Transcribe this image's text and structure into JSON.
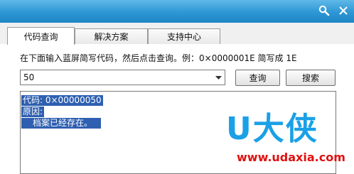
{
  "titlebar": {
    "search_icon": "magnifier-icon",
    "close_icon": "close-icon",
    "color": "#2d96d4"
  },
  "tabs": [
    {
      "label": "代码查询",
      "active": true
    },
    {
      "label": "解决方案",
      "active": false
    },
    {
      "label": "支持中心",
      "active": false
    }
  ],
  "instruction": "在下面输入蓝屏简写代码，然后点击查询。例：0×0000001E 简写成 1E",
  "code_input": {
    "value": "50"
  },
  "buttons": {
    "query": "查询",
    "search": "搜索"
  },
  "result": {
    "code_line": "代码: 0×00000050",
    "reason_line": "原因:",
    "description": "档案已经存在。",
    "selection_color": "#2e5fb0"
  },
  "watermark": {
    "logo": "U大侠",
    "url": "www.udaxia.com",
    "logo_color": "#1aa0e6",
    "url_color": "#e01010"
  }
}
